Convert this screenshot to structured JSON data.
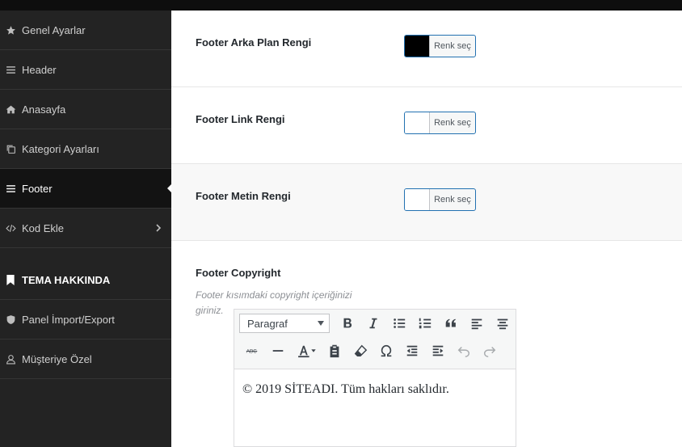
{
  "sidebar": {
    "items": [
      {
        "label": "Genel Ayarlar",
        "icon": "star-icon"
      },
      {
        "label": "Header",
        "icon": "menu-icon"
      },
      {
        "label": "Anasayfa",
        "icon": "home-icon"
      },
      {
        "label": "Kategori Ayarları",
        "icon": "copy-icon"
      },
      {
        "label": "Footer",
        "icon": "menu-icon",
        "active": true
      },
      {
        "label": "Kod Ekle",
        "icon": "code-icon"
      }
    ],
    "section_title": "TEMA HAKKINDA",
    "section_items": [
      {
        "label": "Panel İmport/Export",
        "icon": "shield-icon"
      },
      {
        "label": "Müşteriye Özel",
        "icon": "user-icon"
      }
    ]
  },
  "settings": {
    "footer_bg": {
      "label": "Footer Arka Plan Rengi",
      "button": "Renk seç",
      "color": "#000000"
    },
    "footer_link": {
      "label": "Footer Link Rengi",
      "button": "Renk seç",
      "color": "#ffffff"
    },
    "footer_text": {
      "label": "Footer Metin Rengi",
      "button": "Renk seç",
      "color": "#ffffff"
    },
    "copyright": {
      "label": "Footer Copyright",
      "description": "Footer kısımdaki copyright içeriğinizi giriniz.",
      "format_select": "Paragraf",
      "content": "© 2019 SİTEADI. Tüm hakları saklıdır."
    }
  },
  "colors": {
    "sidebar_bg": "#232323",
    "active_bg": "#131313",
    "accent": "#2271b1"
  }
}
